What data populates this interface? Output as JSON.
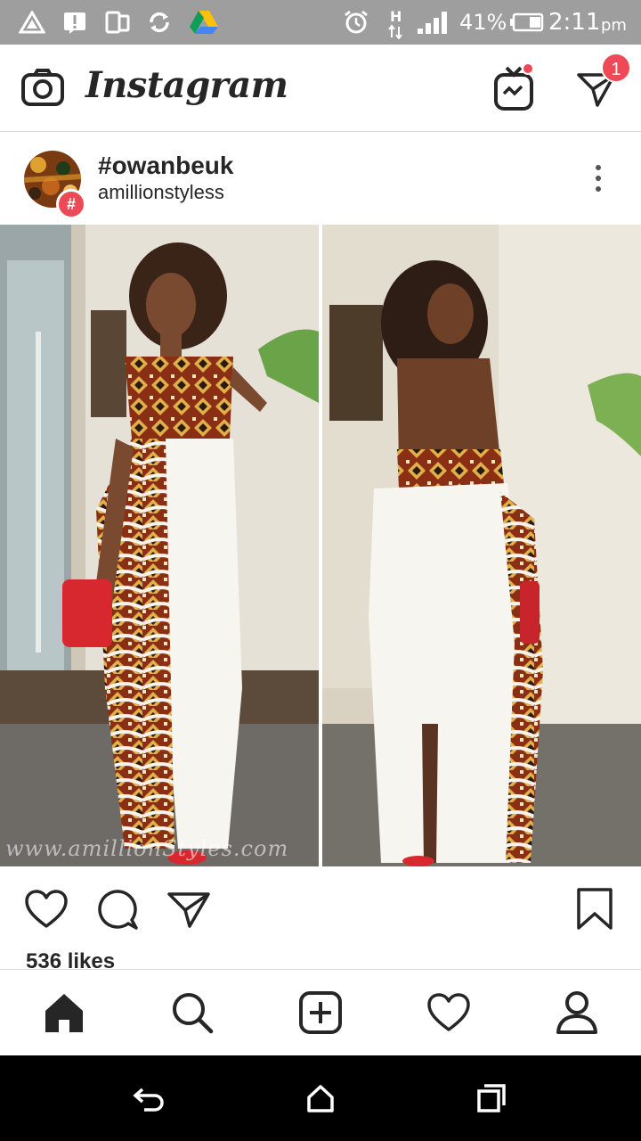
{
  "status_bar": {
    "signal_label": "H",
    "battery_percent": "41%",
    "time": "2:11",
    "ampm": "pm",
    "icons": [
      "triangle-icon",
      "alert-icon",
      "phone-icon",
      "sync-icon",
      "drive-icon",
      "alarm-icon",
      "data-arrows-icon",
      "signal-bars-icon",
      "battery-icon"
    ]
  },
  "app_header": {
    "logo_text": "Instagram",
    "notification_count": "1",
    "icons": [
      "camera-icon",
      "igtv-icon",
      "direct-message-icon"
    ]
  },
  "post": {
    "title": "#owanbeuk",
    "subtitle": "amillionstyless",
    "hashtag_badge": "#",
    "watermark": "www.amillionStyles.com",
    "likes": "536 likes"
  },
  "actions": {
    "icons": [
      "heart-icon",
      "comment-icon",
      "share-icon",
      "bookmark-icon"
    ]
  },
  "bottom_nav": {
    "icons": [
      "home-icon",
      "search-icon",
      "add-post-icon",
      "activity-heart-icon",
      "profile-icon"
    ]
  },
  "android_nav": {
    "icons": [
      "back-icon",
      "home-nav-icon",
      "recents-icon"
    ]
  },
  "colors": {
    "status_bar": "#9e9e9e",
    "badge_red": "#ed4956",
    "text": "#262626",
    "divider": "#dbdbdb"
  }
}
